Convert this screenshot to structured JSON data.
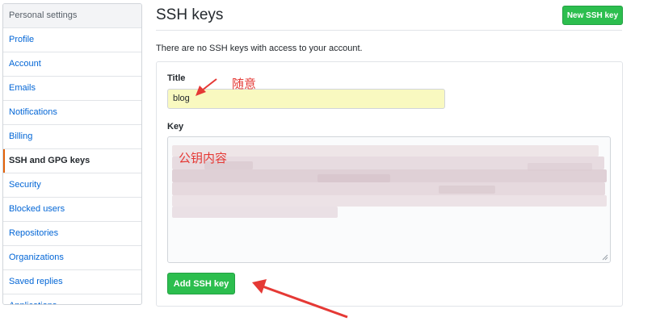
{
  "sidebar": {
    "header": "Personal settings",
    "items": [
      {
        "label": "Profile"
      },
      {
        "label": "Account"
      },
      {
        "label": "Emails"
      },
      {
        "label": "Notifications"
      },
      {
        "label": "Billing"
      },
      {
        "label": "SSH and GPG keys"
      },
      {
        "label": "Security"
      },
      {
        "label": "Blocked users"
      },
      {
        "label": "Repositories"
      },
      {
        "label": "Organizations"
      },
      {
        "label": "Saved replies"
      },
      {
        "label": "Applications"
      }
    ]
  },
  "main": {
    "page_title": "SSH keys",
    "new_key_button": "New SSH key",
    "notice": "There are no SSH keys with access to your account.",
    "form": {
      "title_label": "Title",
      "title_value": "blog",
      "key_label": "Key",
      "submit_label": "Add SSH key"
    }
  },
  "annotations": {
    "title_note": "随意",
    "key_note": "公钥内容"
  },
  "colors": {
    "accent_green": "#2cbe4e",
    "link_blue": "#0366d6",
    "active_marker": "#e36209",
    "annotation_red": "#e53935",
    "input_highlight": "#f9f9c0"
  }
}
